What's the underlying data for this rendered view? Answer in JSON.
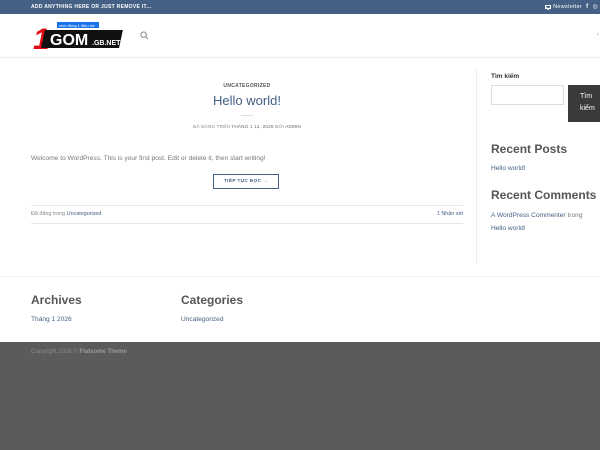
{
  "topbar": {
    "left_text": "ADD ANYTHING HERE OR JUST REMOVE IT...",
    "newsletter_label": "Newsletter",
    "social_facebook": "f",
    "social_instagram": "◎"
  },
  "logo": {
    "digit": "1",
    "wordmark": "GOM",
    "domain": ".GB.NET",
    "tagline": "xem đồng 1 điều trờ"
  },
  "header": {
    "edge_glyph": "‹"
  },
  "post": {
    "category": "UNCATEGORIZED",
    "title": "Hello world!",
    "meta_prefix": "ĐÃ ĐĂNG TRÊN ",
    "meta_date": "THÁNG 1 14, 2026",
    "meta_by": " BỞI ",
    "meta_author": "ADMIN",
    "excerpt": "Welcome to WordPress. This is your first post. Edit or delete it, then start writing!",
    "read_more": "TIẾP TỤC ĐỌC →",
    "footer_prefix": "Đã đăng trong ",
    "footer_category": "Uncategorized",
    "comments": "1 Nhận xét"
  },
  "sidebar": {
    "search_label": "Tìm kiếm",
    "search_button_line1": "Tìm",
    "search_button_line2": "kiếm",
    "recent_posts_heading": "Recent Posts",
    "recent_posts": [
      "Hello world!"
    ],
    "recent_comments_heading": "Recent Comments",
    "comment_author": "A WordPress Commenter",
    "comment_on": " trong",
    "comment_post": "Hello world!"
  },
  "footer_widgets": {
    "archives_heading": "Archives",
    "archives_item": "Tháng 1 2026",
    "categories_heading": "Categories",
    "categories_item": "Uncategorized"
  },
  "footer": {
    "copyright_prefix": "Copyright 2026 © ",
    "copyright_brand": "Flatsome Theme"
  },
  "colors": {
    "primary": "#446084",
    "footer_bg": "#5b5b5b"
  }
}
